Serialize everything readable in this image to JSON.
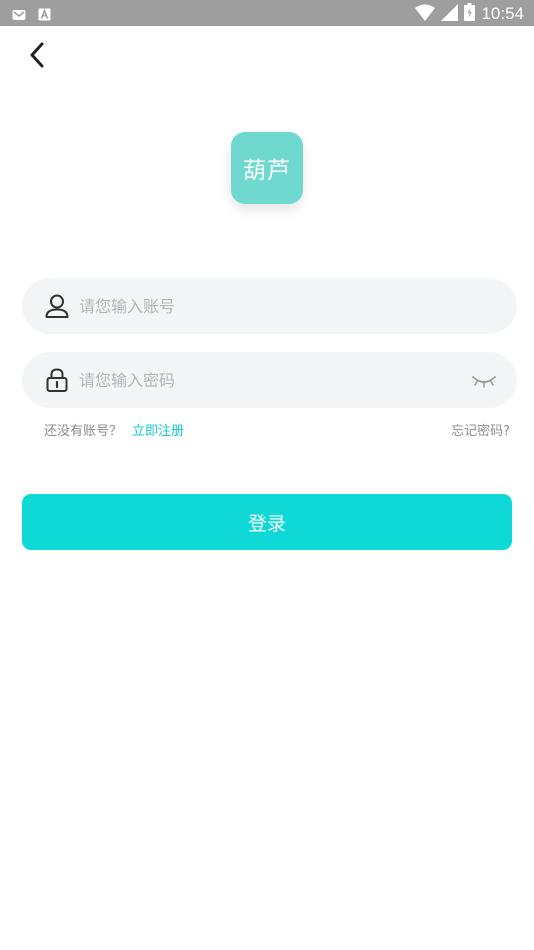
{
  "status_bar": {
    "time": "10:54",
    "left_icons": [
      "gmail-icon",
      "a-notification-icon"
    ],
    "right_icons": [
      "wifi-icon",
      "signal-icon",
      "battery-icon"
    ],
    "background": "#9e9e9e"
  },
  "header": {
    "back_icon": "chevron-left-icon"
  },
  "logo": {
    "text": "葫芦",
    "color": "#6fd9d0"
  },
  "form": {
    "account": {
      "icon": "user-icon",
      "placeholder": "请您输入账号",
      "value": ""
    },
    "password": {
      "icon": "lock-icon",
      "placeholder": "请您输入密码",
      "value": "",
      "toggle_icon": "eye-closed-icon"
    }
  },
  "links": {
    "no_account": "还没有账号？",
    "register": "立即注册",
    "forgot": "忘记密码?"
  },
  "login_button": {
    "label": "登录",
    "color": "#0ed9d6"
  }
}
